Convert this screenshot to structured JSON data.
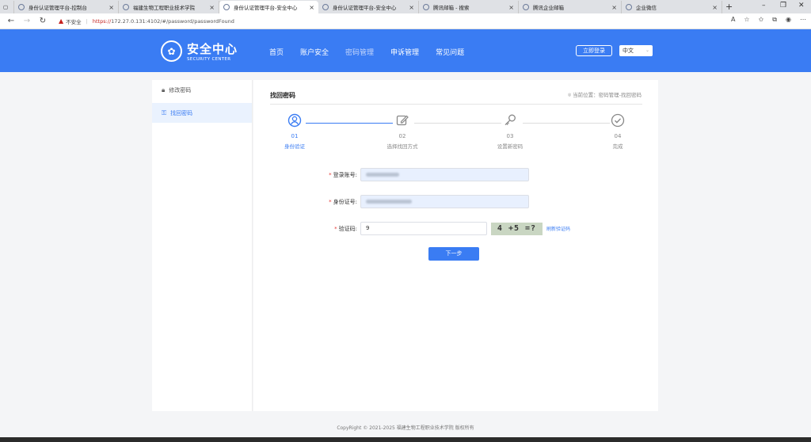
{
  "browser": {
    "tabs": [
      {
        "title": "身份认证管理平台-控制台",
        "active": false
      },
      {
        "title": "福建生物工程职业技术学院",
        "active": false
      },
      {
        "title": "身份认证管理平台-安全中心",
        "active": true
      },
      {
        "title": "身份认证管理平台-安全中心",
        "active": false
      },
      {
        "title": "腾讯邮箱 - 搜索",
        "active": false
      },
      {
        "title": "腾讯企业邮箱",
        "active": false
      },
      {
        "title": "企业微信",
        "active": false
      }
    ],
    "security_label": "不安全",
    "url_protocol": "https://",
    "url_rest": "172.27.0.131:4102/#/password/passwordFound"
  },
  "header": {
    "logo_cn": "安全中心",
    "logo_en": "SECURITY CENTER",
    "nav": [
      {
        "label": "首页",
        "current": false
      },
      {
        "label": "账户安全",
        "current": false
      },
      {
        "label": "密码管理",
        "current": true
      },
      {
        "label": "申诉管理",
        "current": false
      },
      {
        "label": "常见问题",
        "current": false
      }
    ],
    "login_label": "立即登录",
    "language": "中文"
  },
  "sidebar": {
    "items": [
      {
        "label": "修改密码",
        "icon": "lock-icon",
        "active": false
      },
      {
        "label": "找回密码",
        "icon": "key-icon",
        "active": true
      }
    ]
  },
  "main": {
    "title": "找回密码",
    "breadcrumb": "当前位置：密码管理-找回密码",
    "steps": [
      {
        "num": "01",
        "label": "身份验证",
        "icon": "user-circle-icon",
        "active": true
      },
      {
        "num": "02",
        "label": "选择找回方式",
        "icon": "edit-icon",
        "active": false
      },
      {
        "num": "03",
        "label": "设置新密码",
        "icon": "key-icon",
        "active": false
      },
      {
        "num": "04",
        "label": "完成",
        "icon": "check-circle-icon",
        "active": false
      }
    ],
    "form": {
      "account_label": "登录账号:",
      "idcard_label": "身份证号:",
      "captcha_label": "验证码:",
      "captcha_value": "9",
      "captcha_image_text": "4 +5 =?",
      "refresh_label": "刷新验证码"
    },
    "next_label": "下一步"
  },
  "footer": "CopyRight © 2021-2025 福建生物工程职业技术学院 版权所有"
}
